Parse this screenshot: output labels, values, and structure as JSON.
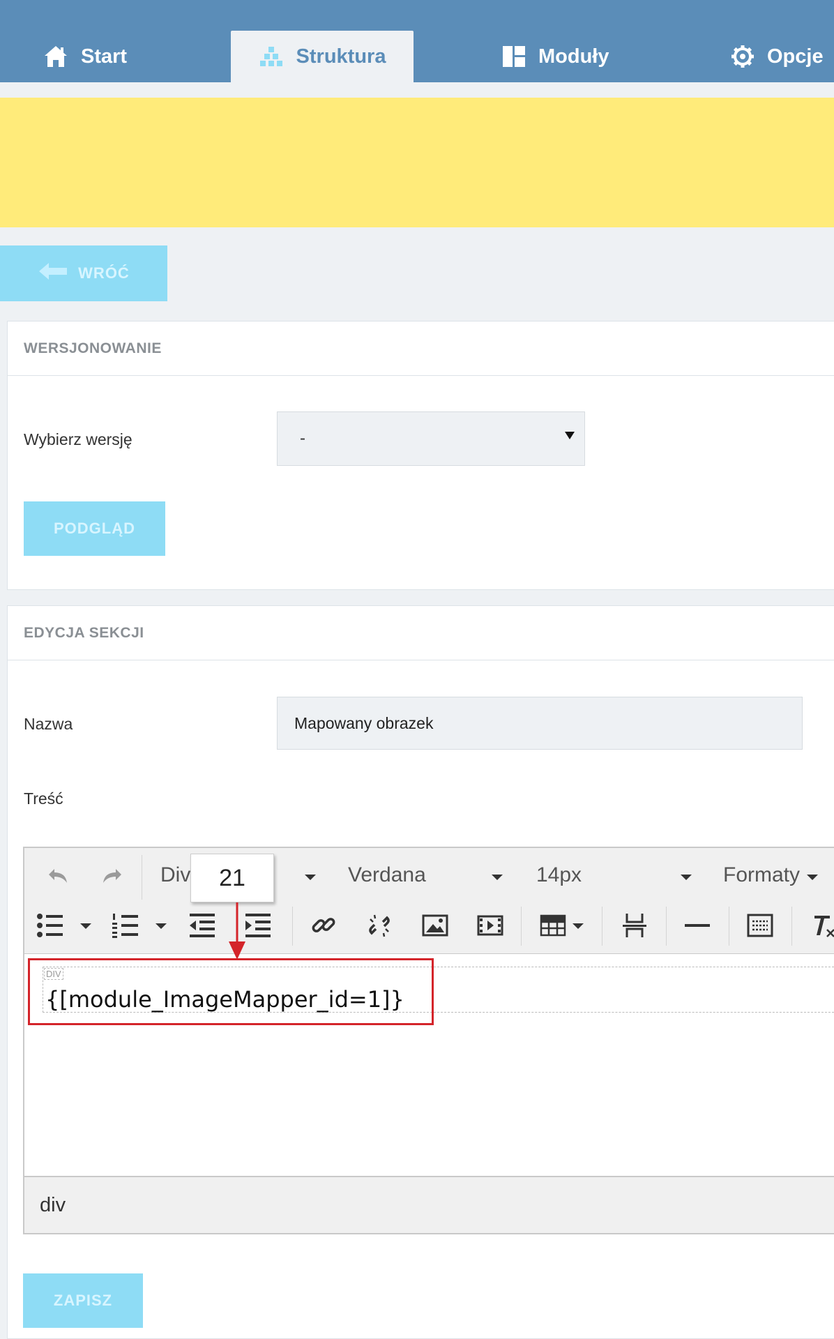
{
  "nav": {
    "tabs": [
      {
        "label": "Start",
        "icon": "home-icon"
      },
      {
        "label": "Struktura",
        "icon": "structure-icon"
      },
      {
        "label": "Moduły",
        "icon": "modules-icon"
      },
      {
        "label": "Opcje",
        "icon": "gear-icon"
      }
    ],
    "active_tab": "Struktura"
  },
  "back_button": {
    "label": "WRÓĆ"
  },
  "versioning": {
    "header": "WERSJONOWANIE",
    "select_label": "Wybierz wersję",
    "select_value": "-",
    "preview_button": "PODGLĄD"
  },
  "section_edit": {
    "header": "EDYCJA SEKCJI",
    "name_label": "Nazwa",
    "name_value": "Mapowany obrazek",
    "content_label": "Treść",
    "save_button": "ZAPISZ"
  },
  "editor": {
    "block_format": "Div",
    "popup_value": "21",
    "font_family": "Verdana",
    "font_size": "14px",
    "formats": "Formaty",
    "div_tag": "DIV",
    "content": "{[module_ImageMapper_id=1]}",
    "status_path": "div"
  },
  "colors": {
    "nav_bg": "#5b8db8",
    "banner": "#ffeb7a",
    "button": "#8edcf5",
    "highlight": "#d4242a"
  }
}
